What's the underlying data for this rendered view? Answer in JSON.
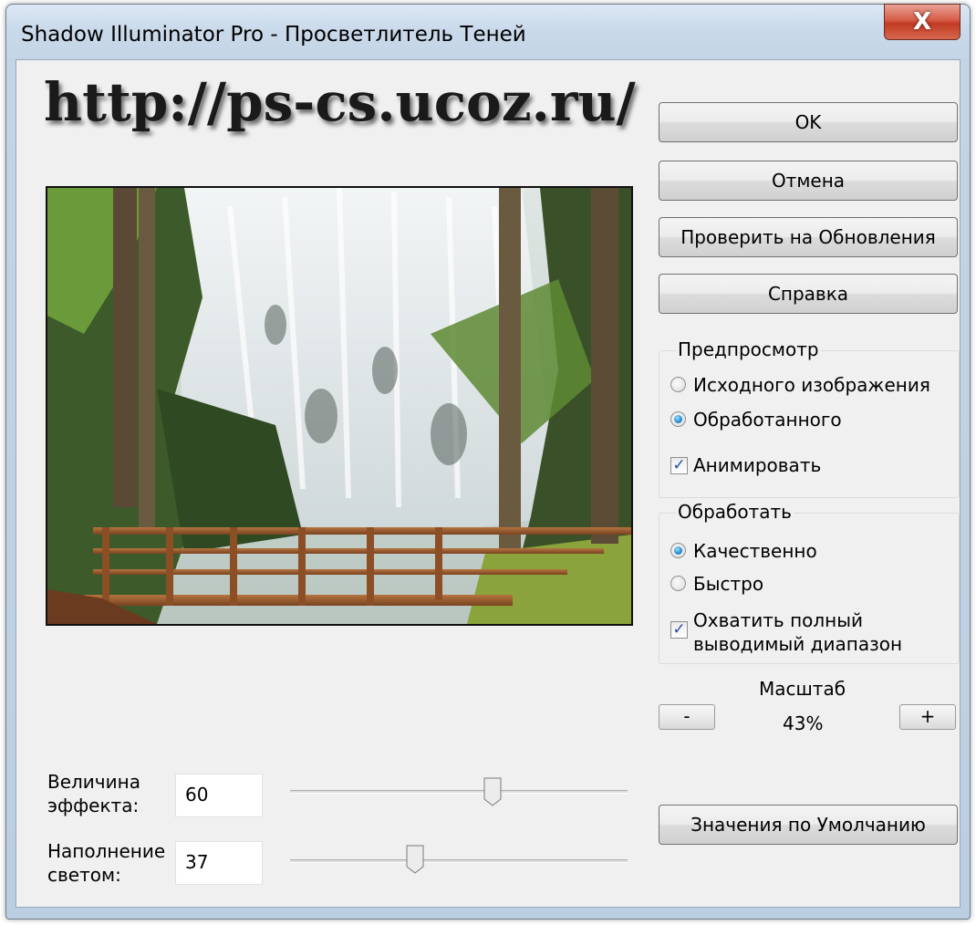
{
  "window": {
    "title": "Shadow Illuminator Pro - Просветлитель Теней",
    "close_glyph": "X"
  },
  "watermark": "http://ps-cs.ucoz.ru/",
  "preview_image": {
    "icon": "waterfall-photo"
  },
  "buttons": {
    "ok": "OK",
    "cancel": "Отмена",
    "check_updates": "Проверить на Обновления",
    "help": "Справка",
    "defaults": "Значения по Умолчанию"
  },
  "preview_group": {
    "title": "Предпросмотр",
    "original": "Исходного изображения",
    "processed": "Обработанного",
    "animate": "Анимировать",
    "selected": "processed",
    "animate_checked": true
  },
  "process_group": {
    "title": "Обработать",
    "quality": "Качественно",
    "fast": "Быстро",
    "full_range_line1": "Охватить полный",
    "full_range_line2": "выводимый диапазон",
    "selected": "quality",
    "full_range_checked": true
  },
  "zoom": {
    "label": "Масштаб",
    "value": "43%",
    "minus": "-",
    "plus": "+"
  },
  "sliders": {
    "effect": {
      "label_line1": "Величина",
      "label_line2": "эффекта:",
      "value": "60",
      "fraction": 0.6
    },
    "fill": {
      "label_line1": "Наполнение",
      "label_line2": "светом:",
      "value": "37",
      "fraction": 0.37
    }
  },
  "colors": {
    "window_frame": "#c3d4e6",
    "close_button": "#c23a22",
    "client_bg": "#f0f0f0",
    "radio_selected": "#2a8fd0",
    "check_mark": "#2b4f9e"
  }
}
